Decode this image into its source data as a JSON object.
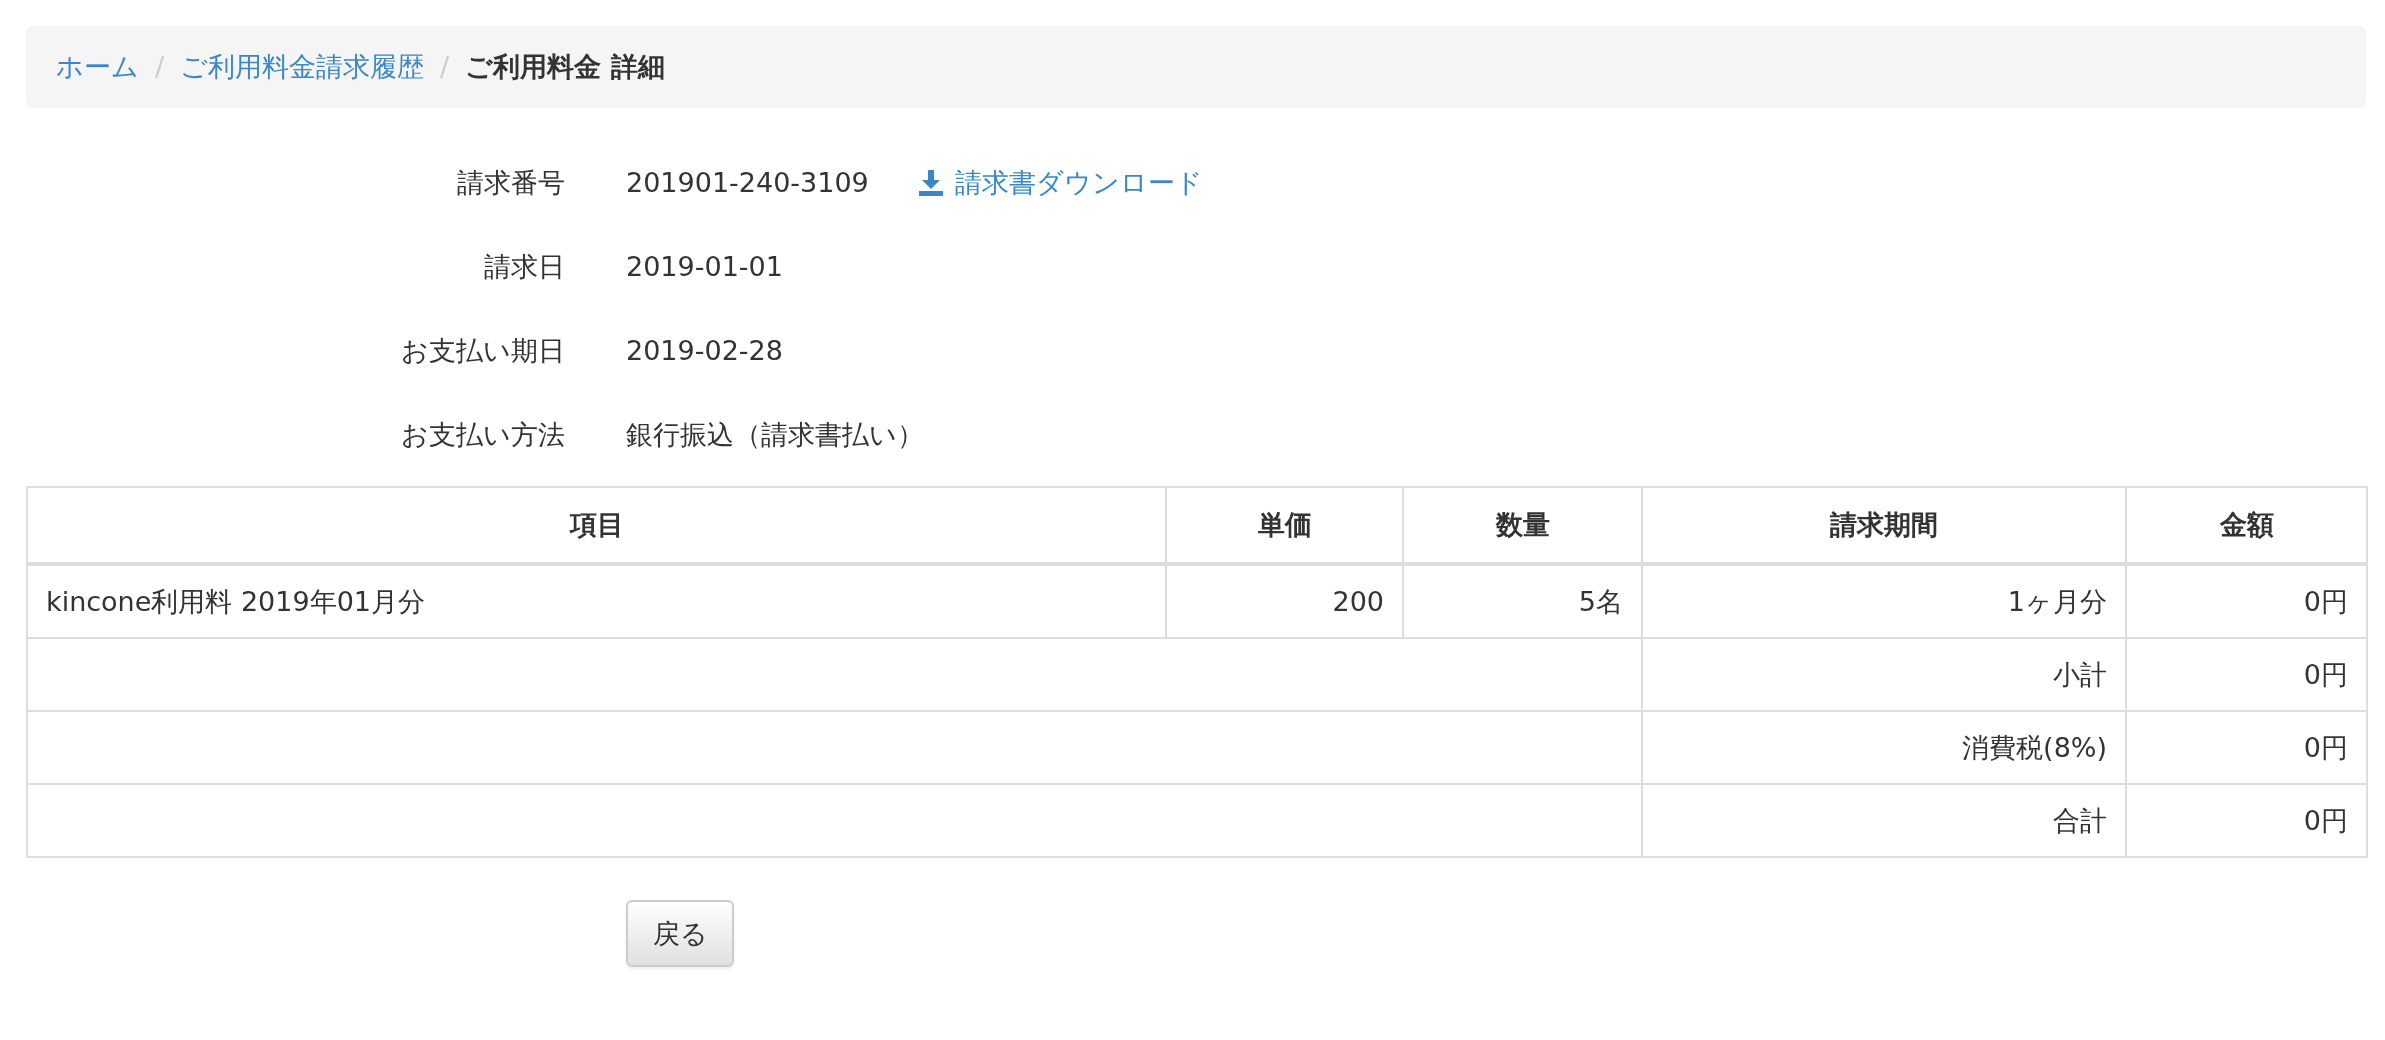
{
  "breadcrumb": {
    "separator": "/",
    "items": [
      {
        "label": "ホーム",
        "current": false
      },
      {
        "label": "ご利用料金請求履歴",
        "current": false
      },
      {
        "label": "ご利用料金 詳細",
        "current": true
      }
    ]
  },
  "details": [
    {
      "label": "請求番号",
      "value": "201901-240-3109",
      "download_link": {
        "label": "請求書ダウンロード"
      }
    },
    {
      "label": "請求日",
      "value": "2019-01-01"
    },
    {
      "label": "お支払い期日",
      "value": "2019-02-28"
    },
    {
      "label": "お支払い方法",
      "value": "銀行振込（請求書払い）"
    }
  ],
  "table": {
    "columns": [
      "項目",
      "単価",
      "数量",
      "請求期間",
      "金額"
    ],
    "rows": [
      {
        "kind": "item",
        "cells": [
          "kincone利用料 2019年01月分",
          "200",
          "5名",
          "1ヶ月分",
          "0円"
        ]
      },
      {
        "kind": "summary",
        "label": "小計",
        "amount": "0円"
      },
      {
        "kind": "summary",
        "label": "消費税(8%)",
        "amount": "0円"
      },
      {
        "kind": "summary",
        "label": "合計",
        "amount": "0円"
      }
    ]
  },
  "back_button": {
    "label": "戻る"
  }
}
